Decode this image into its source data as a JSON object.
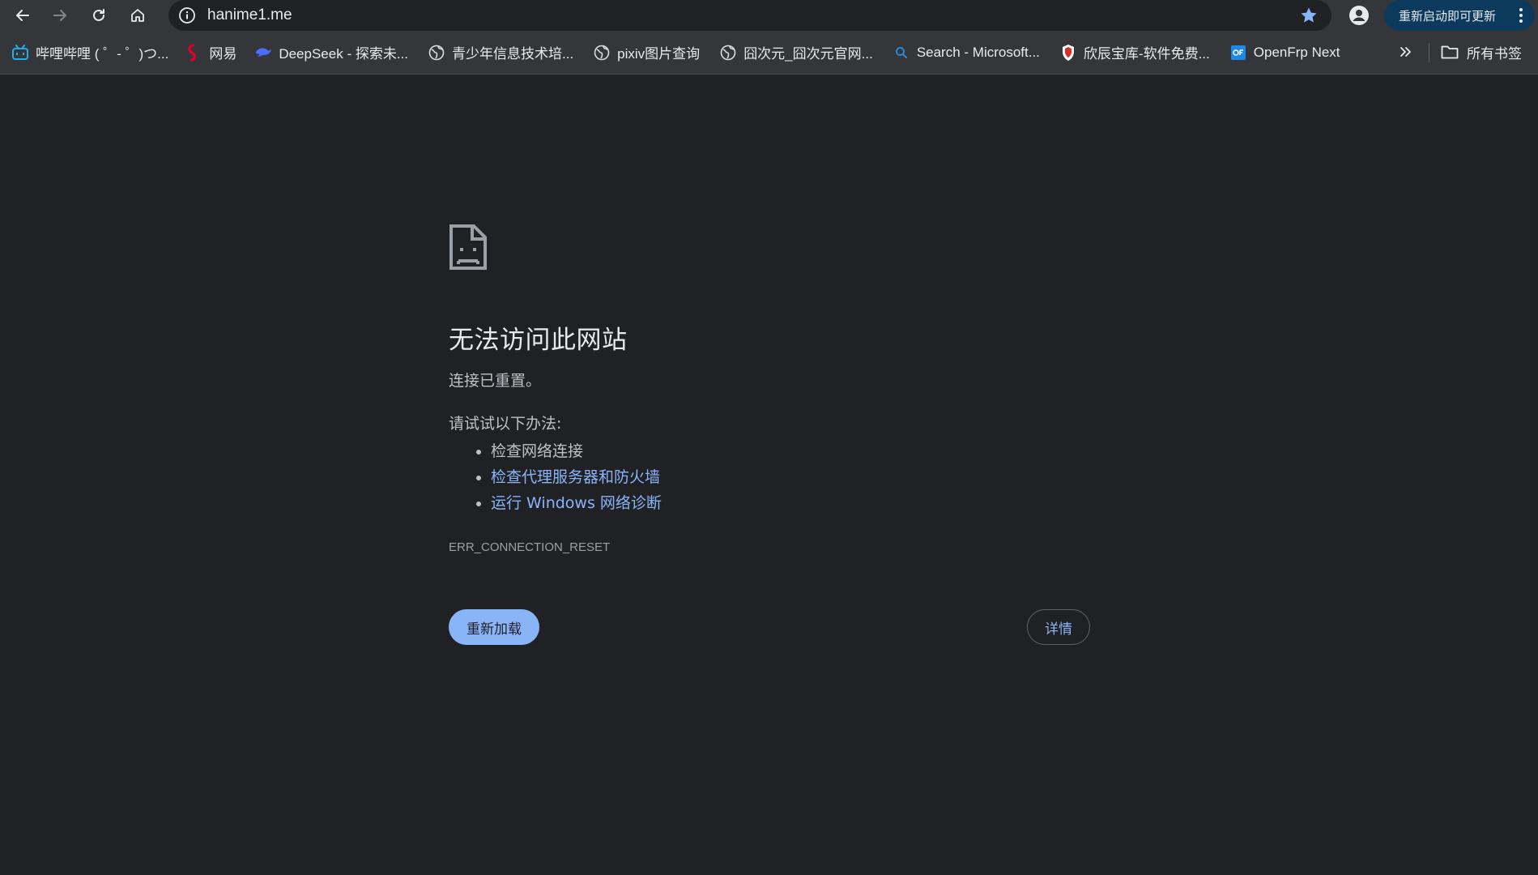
{
  "toolbar": {
    "back_icon": "arrow-left-icon",
    "forward_icon": "arrow-right-icon",
    "reload_icon": "reload-icon",
    "home_icon": "home-icon",
    "url": "hanime1.me",
    "site_info_icon": "info-icon",
    "bookmark_star_icon": "star-icon",
    "profile_icon": "person-icon",
    "update_label": "重新启动即可更新",
    "menu_icon": "kebab-menu-icon"
  },
  "bookmarks": {
    "items": [
      {
        "label": "哔哩哔哩 ( ゜- ゜)つ...",
        "icon": "bilibili-icon"
      },
      {
        "label": "网易",
        "icon": "netease-icon"
      },
      {
        "label": "DeepSeek - 探索未...",
        "icon": "deepseek-icon"
      },
      {
        "label": "青少年信息技术培...",
        "icon": "globe-icon"
      },
      {
        "label": "pixiv图片查询",
        "icon": "globe-icon"
      },
      {
        "label": "囧次元_囧次元官网...",
        "icon": "globe-icon"
      },
      {
        "label": "Search - Microsoft...",
        "icon": "search-icon"
      },
      {
        "label": "欣辰宝库-软件免费...",
        "icon": "shield-icon"
      },
      {
        "label": "OpenFrp Next",
        "icon": "openfrp-icon"
      }
    ],
    "overflow_icon": "chevron-double-right-icon",
    "all_bookmarks_label": "所有书签",
    "all_bookmarks_icon": "folder-icon"
  },
  "error": {
    "icon": "sad-page-icon",
    "title": "无法访问此网站",
    "subtitle": "连接已重置。",
    "suggest_heading": "请试试以下办法:",
    "suggestions": [
      {
        "label": "检查网络连接",
        "link": false
      },
      {
        "label": "检查代理服务器和防火墙",
        "link": true
      },
      {
        "label": "运行 Windows 网络诊断",
        "link": true
      }
    ],
    "code": "ERR_CONNECTION_RESET",
    "reload_label": "重新加载",
    "details_label": "详情"
  },
  "colors": {
    "page_bg": "#202124",
    "toolbar_bg": "#35363a",
    "link": "#8ab4f8",
    "update_bg": "#0b3a5d"
  }
}
